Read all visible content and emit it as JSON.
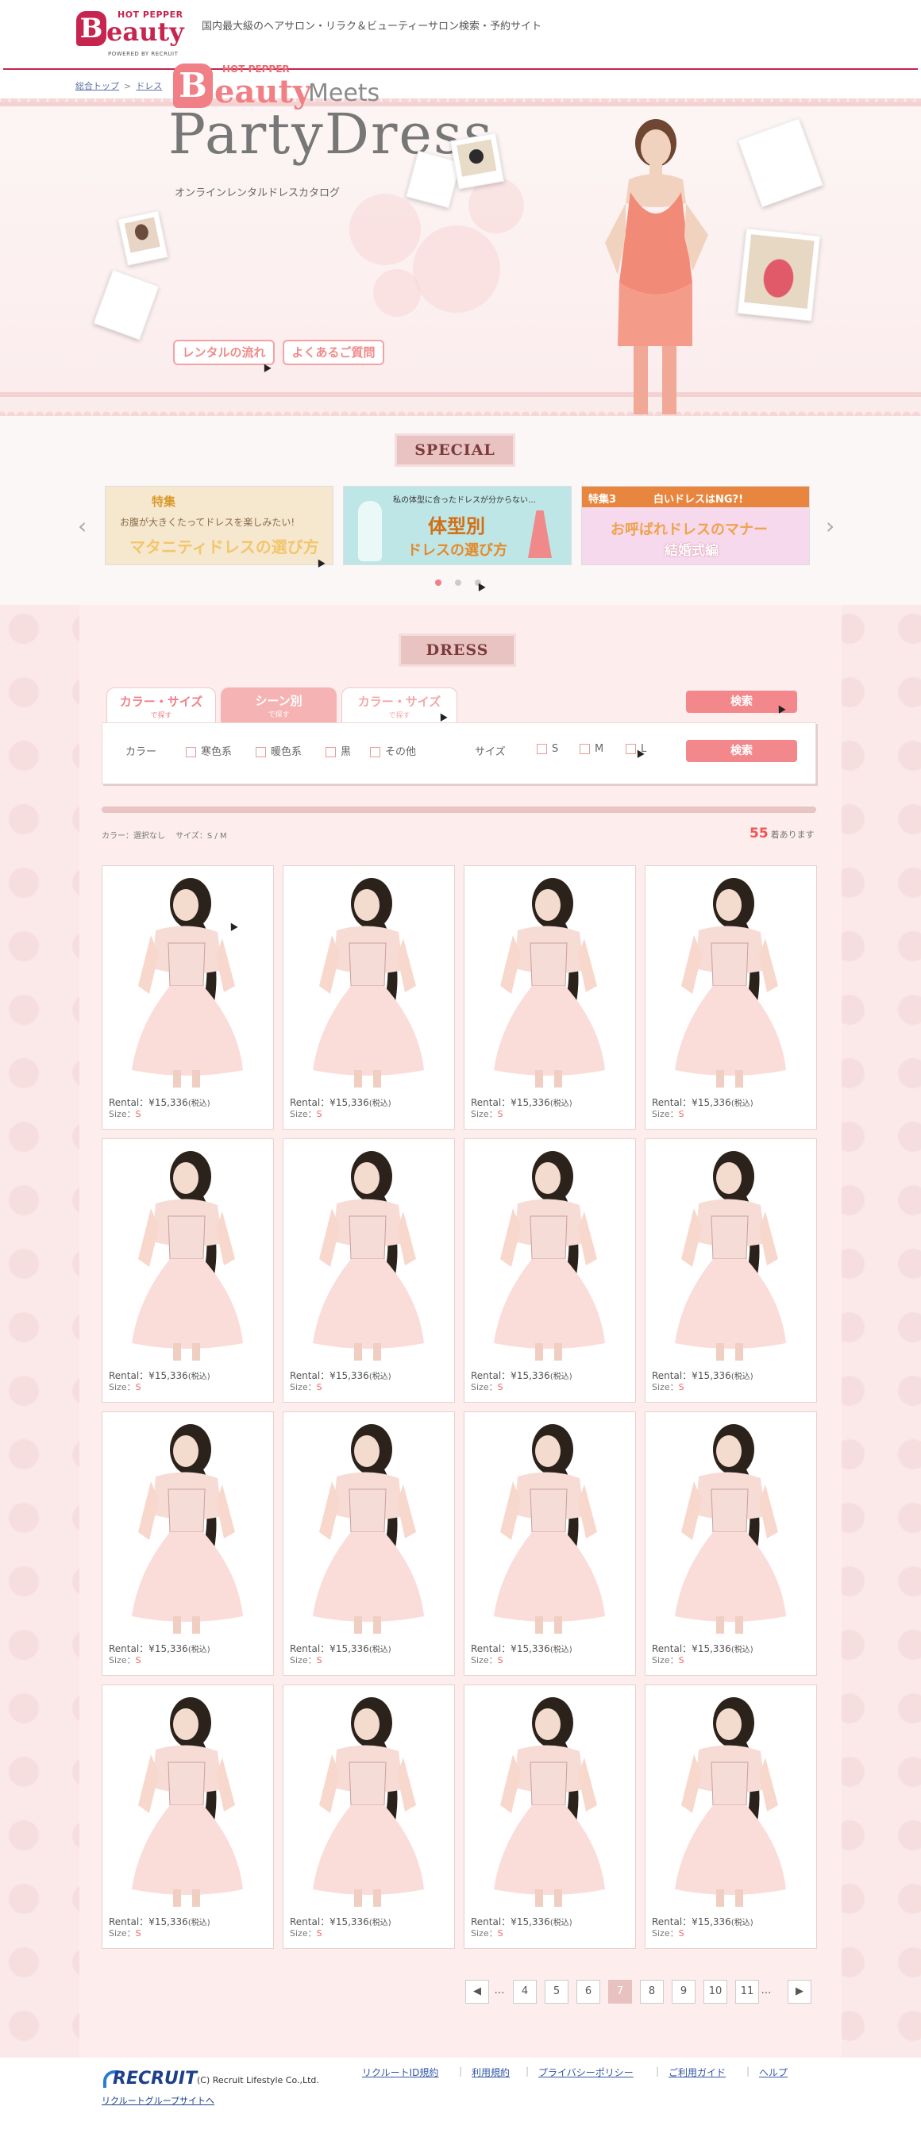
{
  "header": {
    "logo_top": "HOT PEPPER",
    "logo_b": "B",
    "logo_main": "eauty",
    "logo_powered": "POWERED BY RECRUIT",
    "tagline": "国内最大級のヘアサロン・リラク＆ビューティーサロン検索・予約サイト"
  },
  "breadcrumb": {
    "home": "総合トップ",
    "sep": ">",
    "current": "ドレス"
  },
  "hero": {
    "hp": "HOT PEPPER",
    "b": "B",
    "eauty": "eauty",
    "meets": "Meets",
    "title": "PartyDress",
    "subtitle": "オンラインレンタルドレスカタログ",
    "btn_flow": "レンタルの流れ",
    "btn_faq": "よくあるご質問"
  },
  "special": {
    "heading": "SPECIAL",
    "cards": [
      {
        "tag": "特集",
        "line1": "お腹が大きくたってドレスを楽しみたい!",
        "line2": "マタニティドレスの選び方"
      },
      {
        "tag": "私の体型に合ったドレスが分からない…",
        "line1": "体型別",
        "line2": "ドレスの選び方"
      },
      {
        "tag": "特集3",
        "line1": "白いドレスはNG?!",
        "line2": "お呼ばれドレスのマナー",
        "line3": "結婚式編"
      }
    ],
    "prev": "‹",
    "next": "›",
    "colors": {
      "card1": "#f6e7cf",
      "card2": "#bfe6e7",
      "card3": "#f7d9ee",
      "card3_bar": "#e8863f"
    }
  },
  "dress": {
    "heading": "DRESS",
    "tabs": [
      {
        "label": "カラー・サイズ",
        "sub": "で探す"
      },
      {
        "label": "シーン別",
        "sub": "で探す"
      },
      {
        "label": "カラー・サイズ",
        "sub": "で探す"
      }
    ],
    "search_btn_top": "検索",
    "filters": {
      "color_label": "カラー",
      "colors": [
        "寒色系",
        "暖色系",
        "黒",
        "その他"
      ],
      "size_label": "サイズ",
      "sizes": [
        "S",
        "M",
        "L"
      ],
      "search_btn": "検索"
    },
    "condition": "カラー：選択なし　 サイズ：S / M",
    "count_num": "55",
    "count_suffix": "着あります",
    "item": {
      "price": "Rental：¥15,336",
      "tax": "(税込)",
      "size_label": "Size：",
      "size": "S"
    },
    "pagination": [
      "◀",
      "…",
      "4",
      "5",
      "6",
      "7",
      "8",
      "9",
      "10",
      "11",
      "…",
      "▶"
    ],
    "current_page": "7"
  },
  "footer": {
    "recruit": "RECRUIT",
    "copyright": "(C) Recruit Lifestyle Co.,Ltd.",
    "group": "リクルートグループサイトへ",
    "links": [
      "リクルートID規約",
      "利用規約",
      "プライバシーポリシー",
      "ご利用ガイド",
      "ヘルプ"
    ]
  },
  "theme": {
    "brand": "#c5254f",
    "accent": "#f2888c",
    "hero_pink": "#f07f86"
  }
}
